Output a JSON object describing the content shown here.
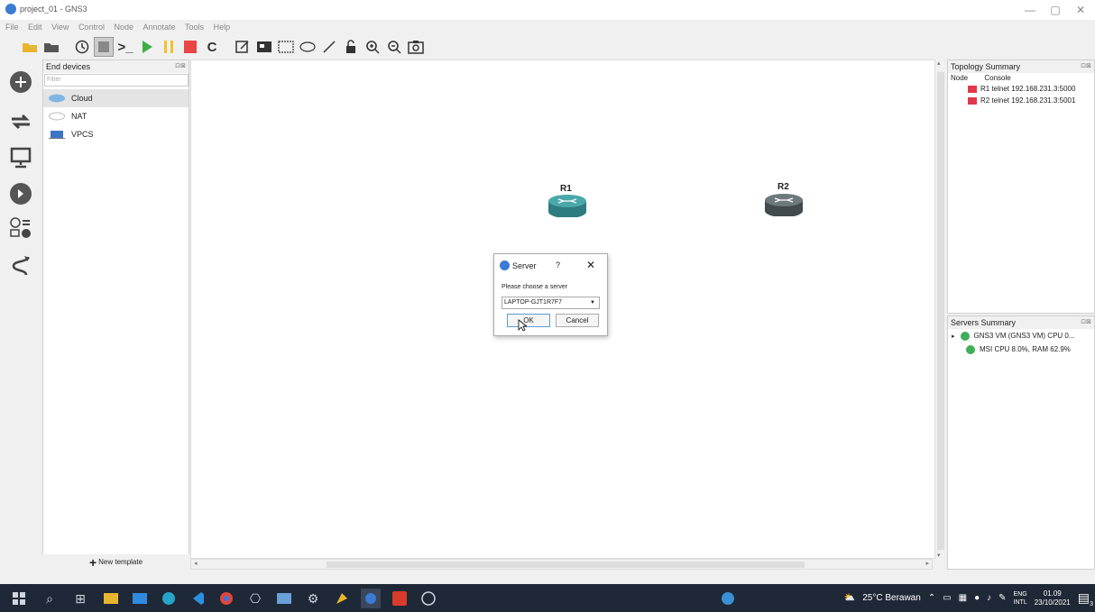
{
  "window": {
    "title": "project_01 - GNS3",
    "minimize": "—",
    "maximize": "▢",
    "close": "✕"
  },
  "menu": [
    "File",
    "Edit",
    "View",
    "Control",
    "Node",
    "Annotate",
    "Tools",
    "Help"
  ],
  "devices_panel": {
    "title": "End devices",
    "filter_placeholder": "Filter",
    "items": [
      {
        "label": "Cloud",
        "icon": "cloud-icon"
      },
      {
        "label": "NAT",
        "icon": "nat-icon"
      },
      {
        "label": "VPCS",
        "icon": "vpcs-icon"
      }
    ],
    "new_template": "New template"
  },
  "canvas": {
    "nodes": [
      {
        "label": "R1",
        "color": "#3f9a9a"
      },
      {
        "label": "R2",
        "color": "#5a6466"
      }
    ]
  },
  "dialog": {
    "title": "Server",
    "help": "?",
    "close": "✕",
    "prompt": "Please choose a server",
    "selected_server": "LAPTOP-GJT1R7F7",
    "ok": "OK",
    "cancel": "Cancel"
  },
  "topology": {
    "title": "Topology Summary",
    "col_node": "Node",
    "col_console": "Console",
    "rows": [
      "R1 telnet 192.168.231.3:5000",
      "R2 telnet 192.168.231.3:5001"
    ]
  },
  "servers": {
    "title": "Servers Summary",
    "rows": [
      "GNS3 VM (GNS3 VM) CPU 0...",
      "MSI CPU 8.0%, RAM 62.9%"
    ]
  },
  "taskbar": {
    "weather": "25°C Berawan",
    "lang_top": "ENG",
    "lang_bottom": "INTL",
    "time": "01.09",
    "date": "23/10/2021",
    "notif_count": "3"
  }
}
